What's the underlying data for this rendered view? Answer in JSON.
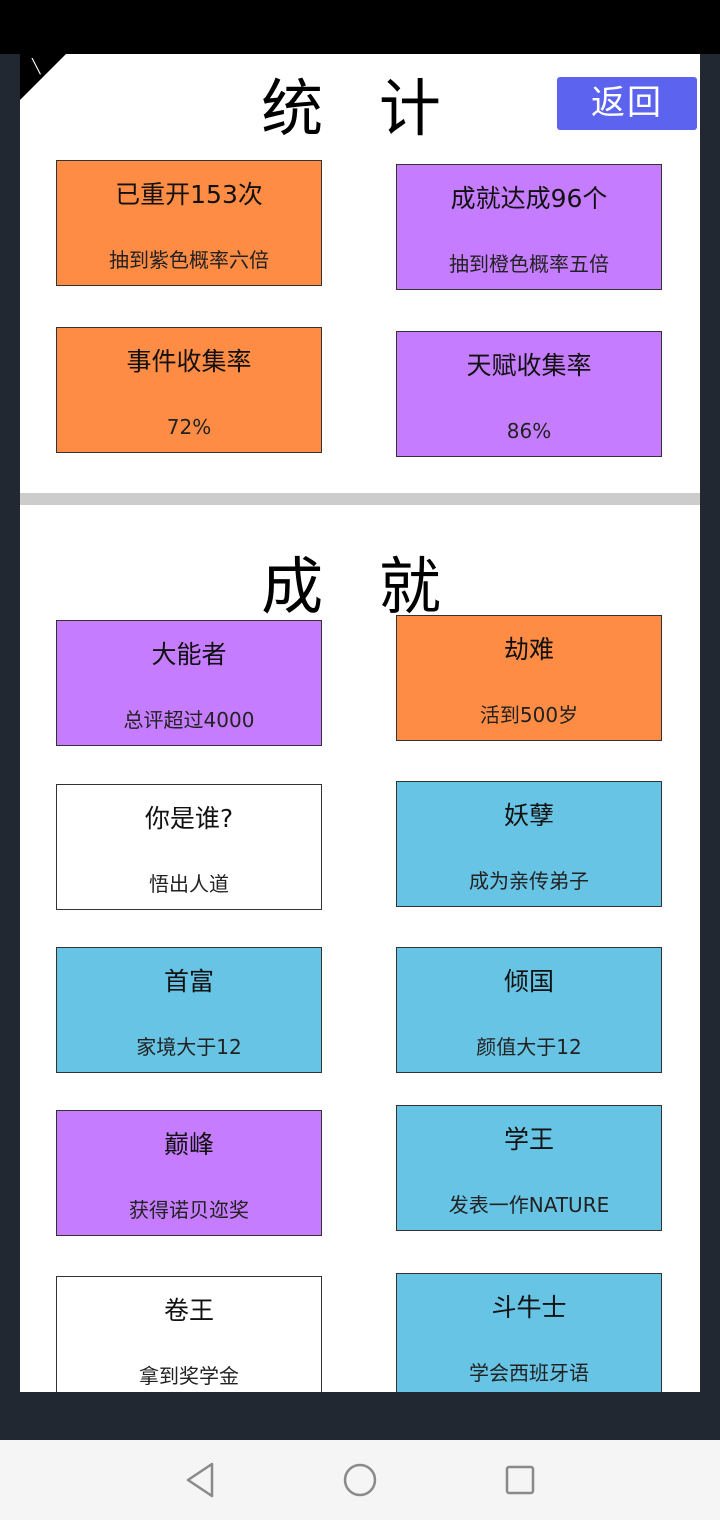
{
  "header": {
    "stats_title": "统 计",
    "back_label": "返回",
    "achievements_title": "成 就"
  },
  "colors": {
    "orange": "#ff8c44",
    "purple": "#c67cff",
    "blue": "#68c4e4",
    "white": "#ffffff",
    "button": "#5b63ef"
  },
  "stats": [
    {
      "title": "已重开153次",
      "desc": "抽到紫色概率六倍",
      "color": "orange"
    },
    {
      "title": "成就达成96个",
      "desc": "抽到橙色概率五倍",
      "color": "purple"
    },
    {
      "title": "事件收集率",
      "desc": "72%",
      "color": "orange"
    },
    {
      "title": "天赋收集率",
      "desc": "86%",
      "color": "purple"
    }
  ],
  "achievements": [
    {
      "title": "大能者",
      "desc": "总评超过4000",
      "color": "purple"
    },
    {
      "title": "劫难",
      "desc": "活到500岁",
      "color": "orange"
    },
    {
      "title": "你是谁?",
      "desc": "悟出人道",
      "color": "white"
    },
    {
      "title": "妖孽",
      "desc": "成为亲传弟子",
      "color": "blue"
    },
    {
      "title": "首富",
      "desc": "家境大于12",
      "color": "blue"
    },
    {
      "title": "倾国",
      "desc": "颜值大于12",
      "color": "blue"
    },
    {
      "title": "巅峰",
      "desc": "获得诺贝迩奖",
      "color": "purple"
    },
    {
      "title": "学王",
      "desc": "发表一作NATURE",
      "color": "blue"
    },
    {
      "title": "卷王",
      "desc": "拿到奖学金",
      "color": "white"
    },
    {
      "title": "斗牛士",
      "desc": "学会西班牙语",
      "color": "blue"
    }
  ],
  "navigation": {
    "back_icon": "triangle-back-icon",
    "home_icon": "circle-home-icon",
    "recents_icon": "square-recents-icon"
  }
}
